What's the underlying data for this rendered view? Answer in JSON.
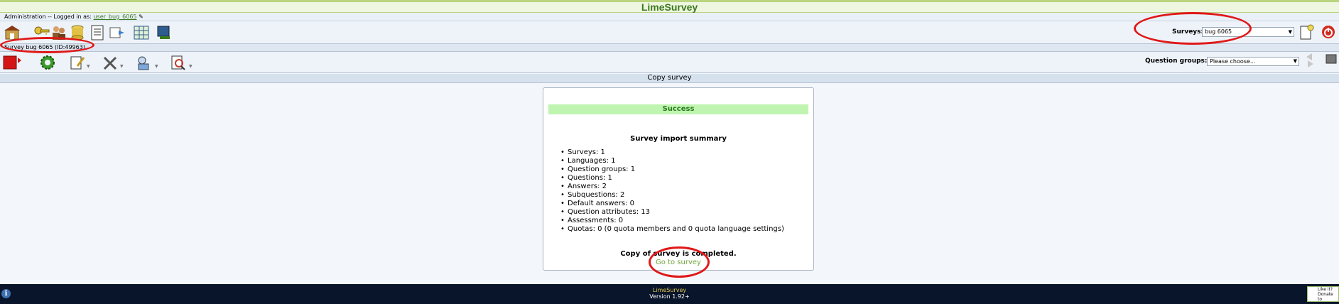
{
  "app": {
    "title": "LimeSurvey"
  },
  "admin": {
    "prefix": "Administration -- Logged in as:",
    "user": "user_bug_6065"
  },
  "surveys": {
    "label": "Surveys:",
    "selected": "bug 6065"
  },
  "survey_bar": {
    "text": "Survey bug 6065 (ID:49963)"
  },
  "question_groups": {
    "label": "Question groups:",
    "placeholder": "Please choose..."
  },
  "page": {
    "header": "Copy survey"
  },
  "result": {
    "status": "Success",
    "summary_title": "Survey import summary",
    "items": [
      "Surveys: 1",
      "Languages: 1",
      "Question groups: 1",
      "Questions: 1",
      "Answers: 2",
      "Subquestions: 2",
      "Default answers: 0",
      "Question attributes: 13",
      "Assessments: 0",
      "Quotas: 0 (0 quota members and 0 quota language settings)"
    ],
    "completed": "Copy of survey is completed.",
    "goto_label": "Go to survey"
  },
  "footer": {
    "brand": "LimeSurvey",
    "version": "Version 1.92+",
    "likeit": "Like it? Donate to LimeSurvey"
  },
  "icons": {
    "toolbar1": [
      "home-icon",
      "keys-icon",
      "users-icon",
      "database-icon",
      "list-icon",
      "data-icon",
      "table-icon",
      "export-icon"
    ],
    "toolbar2": [
      "stop-icon",
      "settings-gear-icon",
      "edit-icon",
      "tools-icon",
      "preview-icon",
      "inspect-icon"
    ],
    "right": [
      "new-survey-icon",
      "logout-icon",
      "nav-arrows-icon",
      "nav-next-icon"
    ]
  },
  "colors": {
    "accent": "#3b7a1e",
    "success_bg": "#bff5b0",
    "link": "#6fa53a",
    "annotation": "#e01818",
    "footer_bg": "#09152a"
  }
}
